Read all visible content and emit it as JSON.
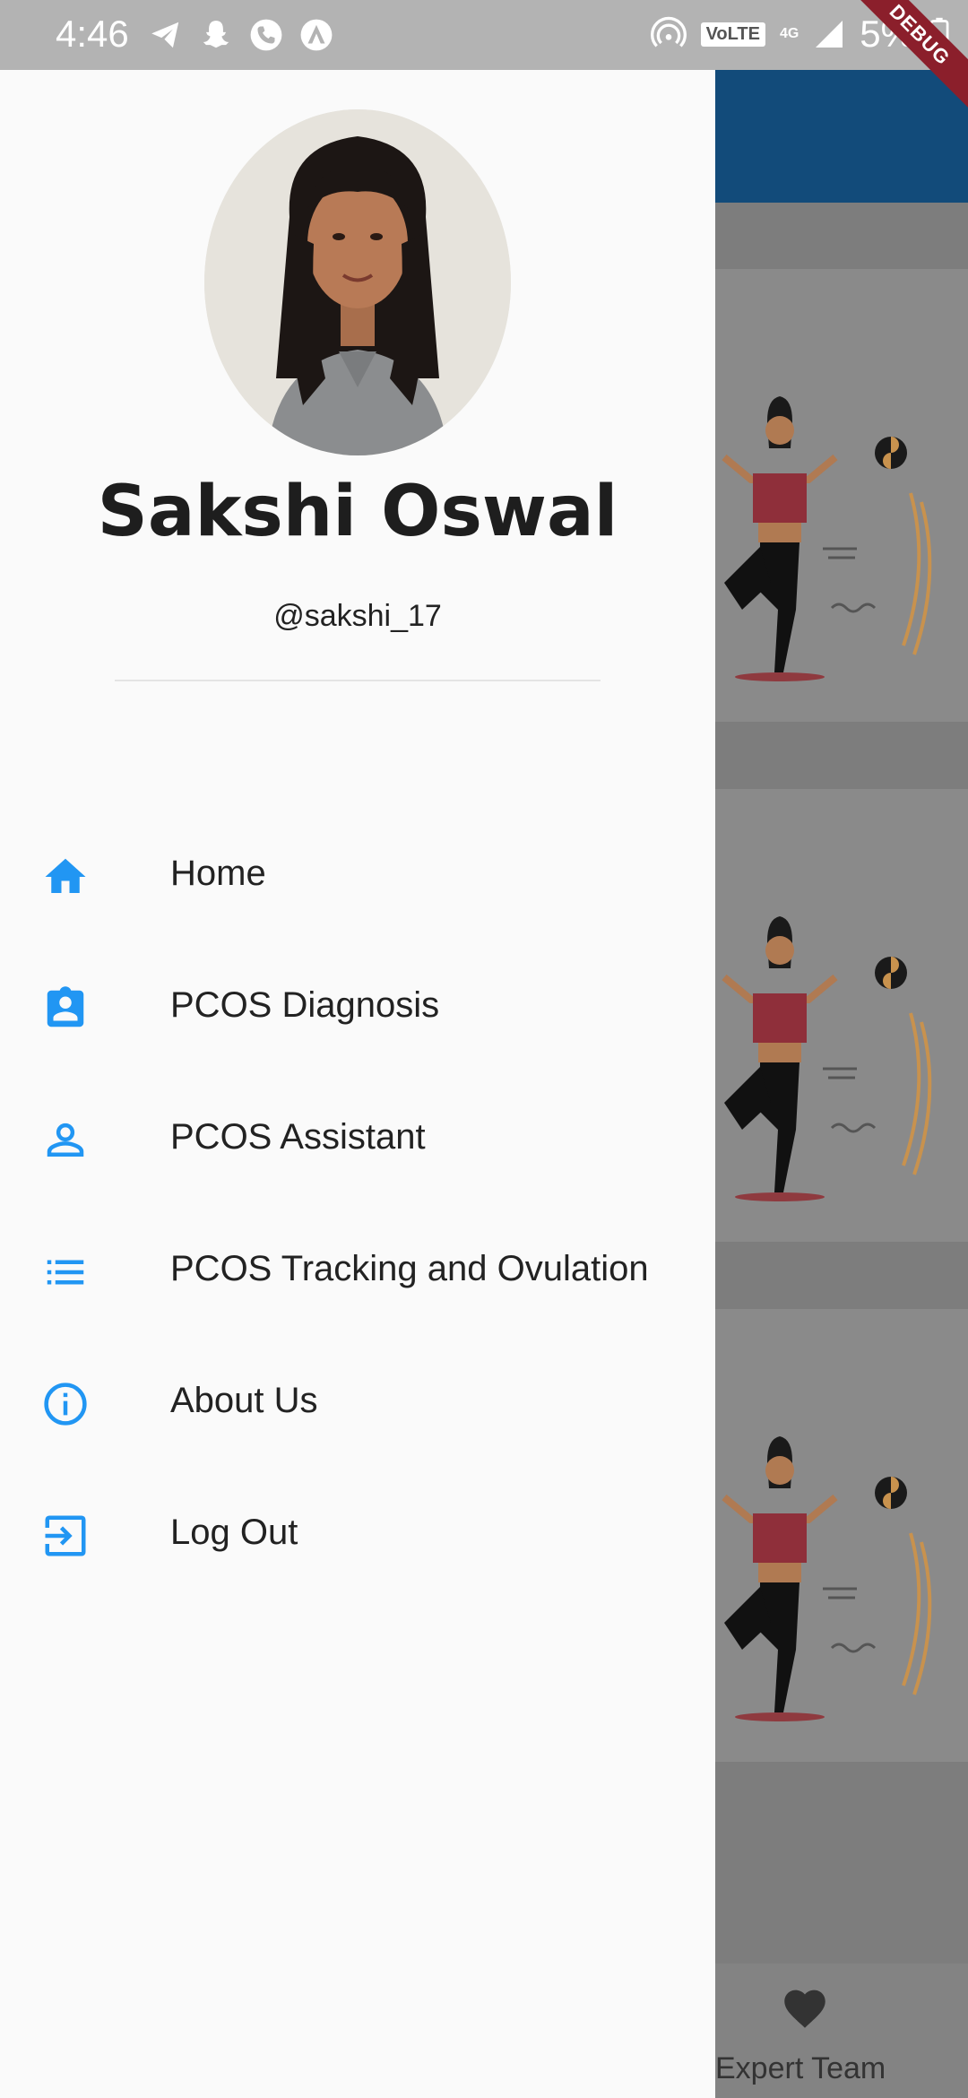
{
  "status_bar": {
    "time": "4:46",
    "battery": "5%",
    "network": "4G",
    "volte": "VoLTE",
    "debug_label": "DEBUG",
    "left_icons": [
      "telegram-icon",
      "snapchat-icon",
      "phone-icon",
      "app-icon"
    ]
  },
  "profile": {
    "name": "Sakshi Oswal",
    "handle": "@sakshi_17"
  },
  "menu": {
    "items": [
      {
        "label": "Home",
        "icon": "home-icon"
      },
      {
        "label": "PCOS Diagnosis",
        "icon": "diagnosis-icon"
      },
      {
        "label": "PCOS Assistant",
        "icon": "person-icon"
      },
      {
        "label": "PCOS Tracking and Ovulation",
        "icon": "list-icon"
      },
      {
        "label": "About Us",
        "icon": "info-icon"
      },
      {
        "label": "Log Out",
        "icon": "logout-icon"
      }
    ]
  },
  "bottom_nav": {
    "expert_team_label": "Expert Team"
  },
  "colors": {
    "accent": "#2196F3",
    "app_bar": "#124b7a",
    "drawer_bg": "#fafafa"
  }
}
